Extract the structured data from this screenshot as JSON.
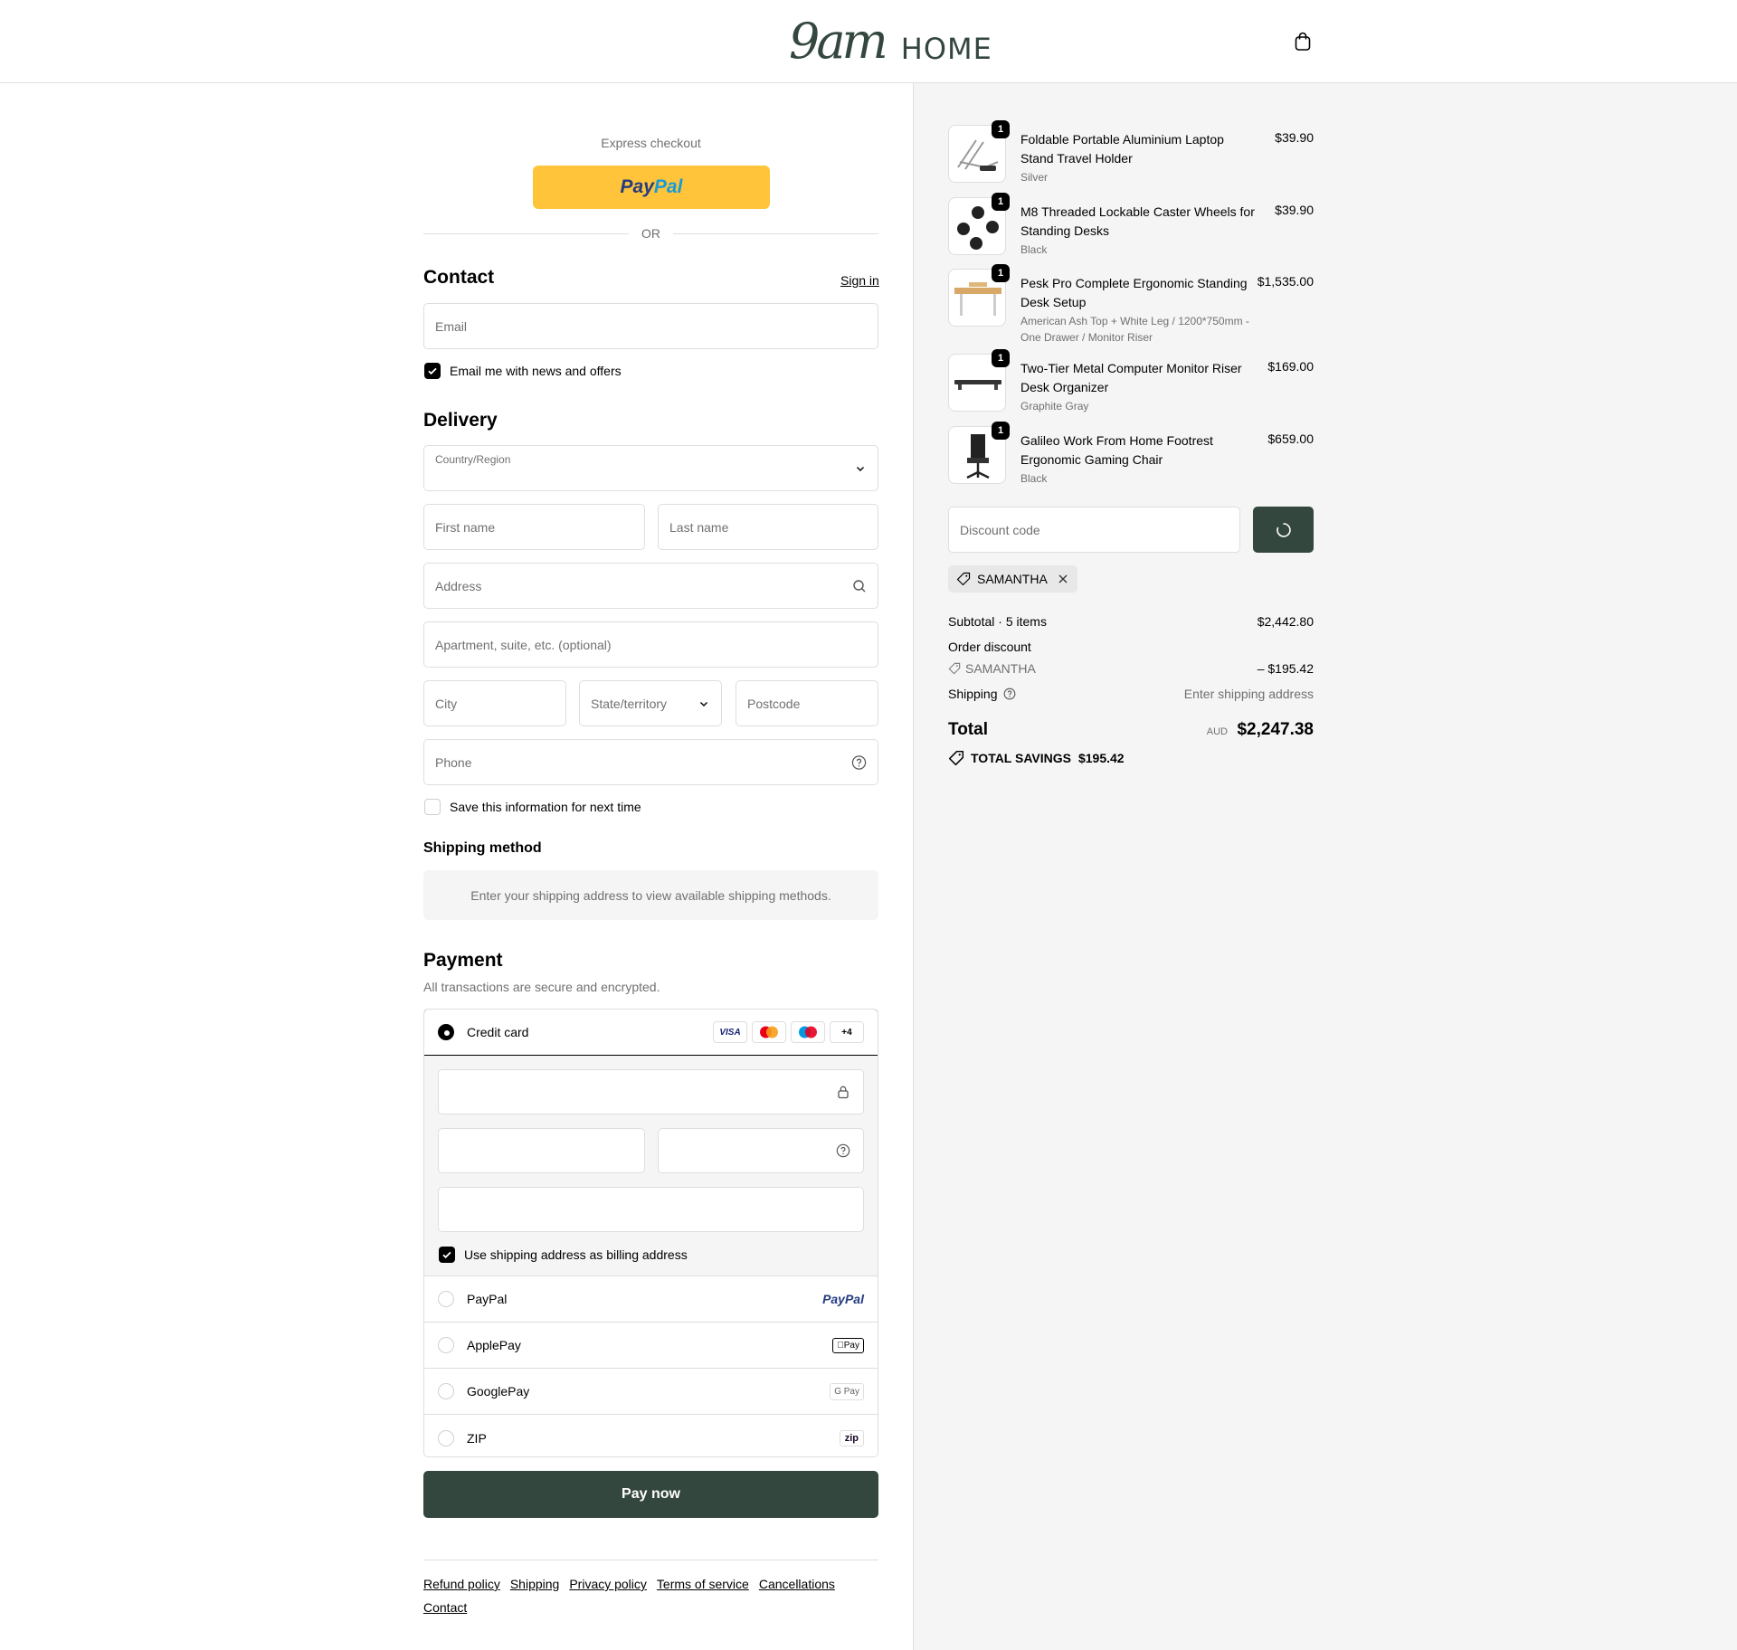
{
  "header": {
    "logo_script": "9am",
    "logo_text": "HOME",
    "cart_icon": "shopping-bag-icon"
  },
  "express": {
    "title": "Express checkout",
    "paypal_a": "Pay",
    "paypal_b": "Pal",
    "or": "OR"
  },
  "contact": {
    "title": "Contact",
    "sign_in": "Sign in",
    "email_placeholder": "Email",
    "newsletter_label": "Email me with news and offers",
    "newsletter_checked": true
  },
  "delivery": {
    "title": "Delivery",
    "country_label": "Country/Region",
    "first_name": "First name",
    "last_name": "Last name",
    "address": "Address",
    "apartment": "Apartment, suite, etc. (optional)",
    "city": "City",
    "state": "State/territory",
    "postcode": "Postcode",
    "phone": "Phone",
    "save_info": "Save this information for next time"
  },
  "shipping_method": {
    "title": "Shipping method",
    "message": "Enter your shipping address to view available shipping methods."
  },
  "payment": {
    "title": "Payment",
    "subtitle": "All transactions are secure and encrypted.",
    "credit_card": "Credit card",
    "card_badges": {
      "visa": "VISA",
      "more": "+4"
    },
    "billing_same": "Use shipping address as billing address",
    "methods": [
      {
        "label": "PayPal",
        "logo": "PayPal"
      },
      {
        "label": "ApplePay",
        "logo": "Pay"
      },
      {
        "label": "GooglePay",
        "logo": "G Pay"
      },
      {
        "label": "ZIP",
        "logo": "zip"
      }
    ],
    "pay_now": "Pay now"
  },
  "footer": {
    "links": [
      "Refund policy",
      "Shipping",
      "Privacy policy",
      "Terms of service",
      "Cancellations",
      "Contact"
    ]
  },
  "cart": {
    "items": [
      {
        "qty": "1",
        "name": "Foldable Portable Aluminium Laptop Stand Travel Holder",
        "variant": "Silver",
        "price": "$39.90"
      },
      {
        "qty": "1",
        "name": "M8 Threaded Lockable Caster Wheels for Standing Desks",
        "variant": "Black",
        "price": "$39.90"
      },
      {
        "qty": "1",
        "name": "Pesk Pro Complete Ergonomic Standing Desk Setup",
        "variant": "American Ash Top + White Leg / 1200*750mm - One Drawer / Monitor Riser",
        "price": "$1,535.00"
      },
      {
        "qty": "1",
        "name": "Two-Tier Metal Computer Monitor Riser Desk Organizer",
        "variant": "Graphite Gray",
        "price": "$169.00"
      },
      {
        "qty": "1",
        "name": "Galileo Work From Home Footrest Ergonomic Gaming Chair",
        "variant": "Black",
        "price": "$659.00"
      }
    ],
    "discount_placeholder": "Discount code",
    "applied_code": "SAMANTHA",
    "subtotal_label": "Subtotal · 5 items",
    "subtotal_value": "$2,442.80",
    "order_discount_label": "Order discount",
    "discount_code": "SAMANTHA",
    "discount_value": "– $195.42",
    "shipping_label": "Shipping",
    "shipping_value": "Enter shipping address",
    "total_label": "Total",
    "currency": "AUD",
    "total_value": "$2,247.38",
    "savings_label": "TOTAL SAVINGS",
    "savings_value": "$195.42"
  },
  "colors": {
    "brand": "#34473e",
    "paypal_yellow": "#ffc439"
  }
}
